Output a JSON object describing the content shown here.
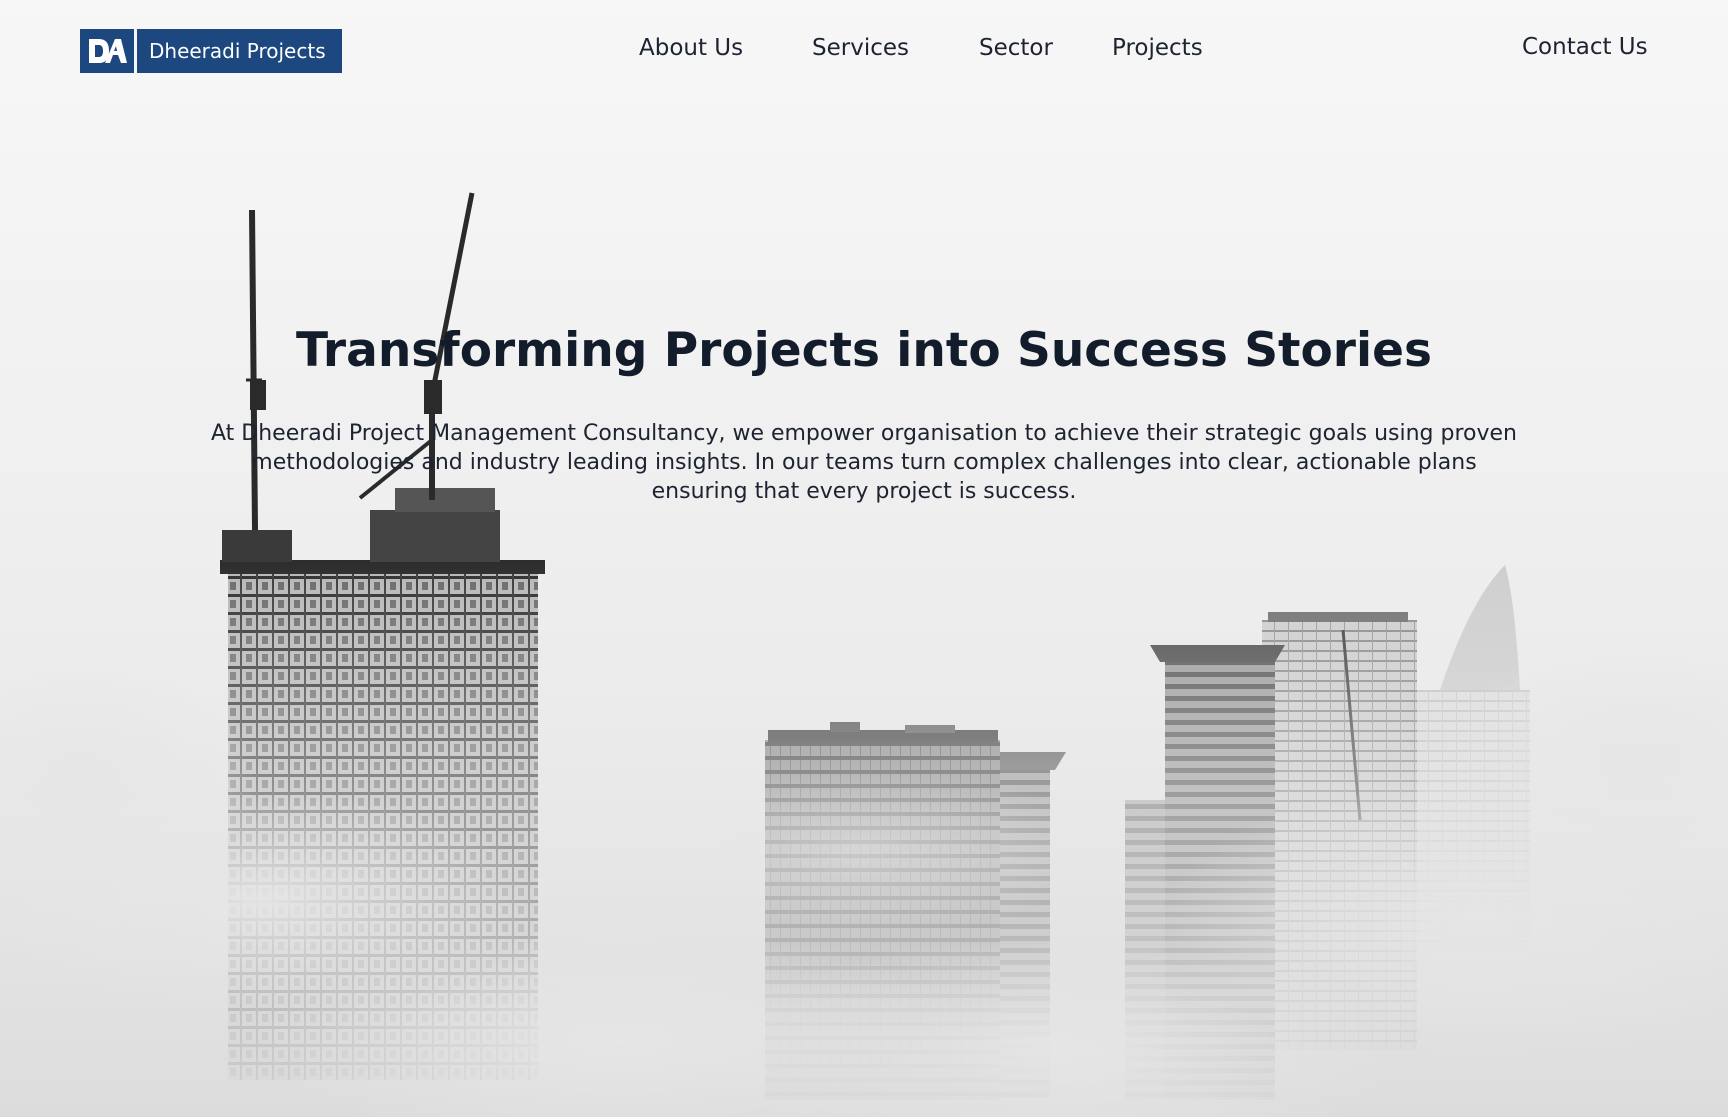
{
  "brand": {
    "logo_mark": "DA",
    "name": "Dheeradi Projects",
    "color": "#1c477f"
  },
  "nav": {
    "about": "About Us",
    "services": "Services",
    "sector": "Sector",
    "projects": "Projects",
    "contact": "Contact Us"
  },
  "hero": {
    "title": "Transforming Projects into Success Stories",
    "description": "At Dheeradi Project Management Consultancy, we empower organisation to achieve their strategic goals using proven methodologies and industry leading insights. In our teams turn complex challenges into clear, actionable plans ensuring that every project is success.",
    "background_image": "foggy city skyline with cranes on a high-rise under construction, black and white"
  },
  "colors": {
    "heading": "#121c2b",
    "text": "#1d2330",
    "background": "#f2f2f2"
  }
}
